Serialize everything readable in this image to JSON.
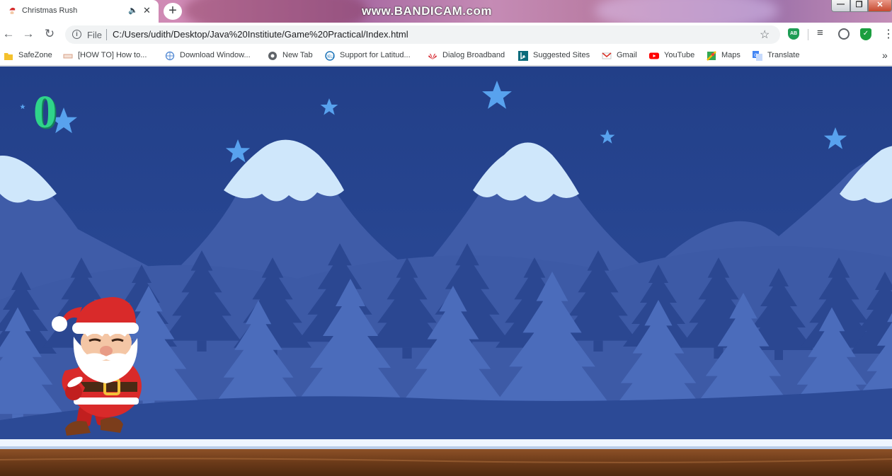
{
  "browser": {
    "tab": {
      "title": "Christmas Rush"
    },
    "watermark": "www.BANDICAM.com",
    "address_bar": {
      "scheme_label": "File",
      "url": "C:/Users/udith/Desktop/Java%20Institiute/Game%20Practical/Index.html"
    },
    "extension_badge": "AB",
    "bookmarks": [
      {
        "label": "SafeZone",
        "icon": "folder-icon"
      },
      {
        "label": "[HOW TO] How to...",
        "icon": "site-favicon"
      },
      {
        "label": "Download Window...",
        "icon": "globe-icon"
      },
      {
        "label": "New Tab",
        "icon": "chrome-newtab-icon"
      },
      {
        "label": "Support for Latitud...",
        "icon": "dell-icon"
      },
      {
        "label": "Dialog Broadband",
        "icon": "huawei-icon"
      },
      {
        "label": "Suggested Sites",
        "icon": "bing-icon"
      },
      {
        "label": "Gmail",
        "icon": "gmail-icon"
      },
      {
        "label": "YouTube",
        "icon": "youtube-icon"
      },
      {
        "label": "Maps",
        "icon": "maps-icon"
      },
      {
        "label": "Translate",
        "icon": "translate-icon"
      }
    ]
  },
  "game": {
    "score": "0",
    "player": "santa",
    "colors": {
      "sky": "#26418a",
      "score": "#2fd48a",
      "ground": "#7a4420",
      "snow": "#eef5ff"
    }
  }
}
